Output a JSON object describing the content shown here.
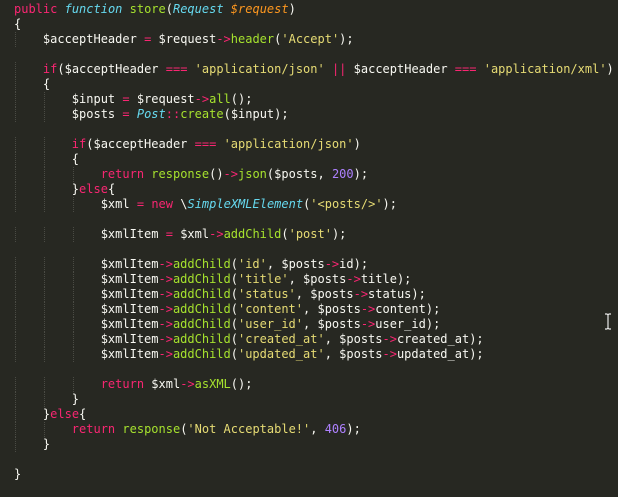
{
  "editor": {
    "language": "php",
    "theme_colors": {
      "background": "#272822",
      "keyword": "#f92672",
      "storage": "#66d9ef",
      "function_name": "#a6e22e",
      "string": "#e6db74",
      "number": "#ae81ff",
      "parameter": "#fd971f",
      "text": "#f8f8f2"
    },
    "lines": [
      {
        "indent": 0,
        "tokens": [
          [
            "kw",
            "public"
          ],
          [
            "tx",
            " "
          ],
          [
            "st",
            "function"
          ],
          [
            "tx",
            " "
          ],
          [
            "fn",
            "store"
          ],
          [
            "pu",
            "("
          ],
          [
            "ty",
            "Request"
          ],
          [
            "tx",
            " "
          ],
          [
            "prm",
            "$request"
          ],
          [
            "pu",
            ")"
          ]
        ]
      },
      {
        "indent": 0,
        "tokens": [
          [
            "pu",
            "{"
          ]
        ]
      },
      {
        "indent": 1,
        "tokens": [
          [
            "var",
            "$acceptHeader"
          ],
          [
            "tx",
            " "
          ],
          [
            "kw",
            "="
          ],
          [
            "tx",
            " "
          ],
          [
            "var",
            "$request"
          ],
          [
            "kw",
            "->"
          ],
          [
            "fn",
            "header"
          ],
          [
            "pu",
            "("
          ],
          [
            "str",
            "'Accept'"
          ],
          [
            "pu",
            ");"
          ]
        ]
      },
      {
        "indent": 0,
        "tokens": []
      },
      {
        "indent": 1,
        "tokens": [
          [
            "kw",
            "if"
          ],
          [
            "pu",
            "("
          ],
          [
            "var",
            "$acceptHeader"
          ],
          [
            "tx",
            " "
          ],
          [
            "kw",
            "==="
          ],
          [
            "tx",
            " "
          ],
          [
            "str",
            "'application/json'"
          ],
          [
            "tx",
            " "
          ],
          [
            "kw",
            "||"
          ],
          [
            "tx",
            " "
          ],
          [
            "var",
            "$acceptHeader"
          ],
          [
            "tx",
            " "
          ],
          [
            "kw",
            "==="
          ],
          [
            "tx",
            " "
          ],
          [
            "str",
            "'application/xml'"
          ],
          [
            "pu",
            ")"
          ]
        ]
      },
      {
        "indent": 1,
        "tokens": [
          [
            "pu",
            "{"
          ]
        ]
      },
      {
        "indent": 2,
        "tokens": [
          [
            "var",
            "$input"
          ],
          [
            "tx",
            " "
          ],
          [
            "kw",
            "="
          ],
          [
            "tx",
            " "
          ],
          [
            "var",
            "$request"
          ],
          [
            "kw",
            "->"
          ],
          [
            "fn",
            "all"
          ],
          [
            "pu",
            "();"
          ]
        ]
      },
      {
        "indent": 2,
        "tokens": [
          [
            "var",
            "$posts"
          ],
          [
            "tx",
            " "
          ],
          [
            "kw",
            "="
          ],
          [
            "tx",
            " "
          ],
          [
            "ty",
            "Post"
          ],
          [
            "kw",
            "::"
          ],
          [
            "fn",
            "create"
          ],
          [
            "pu",
            "("
          ],
          [
            "var",
            "$input"
          ],
          [
            "pu",
            ");"
          ]
        ]
      },
      {
        "indent": 0,
        "tokens": []
      },
      {
        "indent": 2,
        "tokens": [
          [
            "kw",
            "if"
          ],
          [
            "pu",
            "("
          ],
          [
            "var",
            "$acceptHeader"
          ],
          [
            "tx",
            " "
          ],
          [
            "kw",
            "==="
          ],
          [
            "tx",
            " "
          ],
          [
            "str",
            "'application/json'"
          ],
          [
            "pu",
            ")"
          ]
        ]
      },
      {
        "indent": 2,
        "tokens": [
          [
            "pu",
            "{"
          ]
        ]
      },
      {
        "indent": 3,
        "tokens": [
          [
            "kw",
            "return"
          ],
          [
            "tx",
            " "
          ],
          [
            "fn",
            "response"
          ],
          [
            "pu",
            "()"
          ],
          [
            "kw",
            "->"
          ],
          [
            "fn",
            "json"
          ],
          [
            "pu",
            "("
          ],
          [
            "var",
            "$posts"
          ],
          [
            "pu",
            ", "
          ],
          [
            "num",
            "200"
          ],
          [
            "pu",
            ");"
          ]
        ]
      },
      {
        "indent": 2,
        "tokens": [
          [
            "pu",
            "}"
          ],
          [
            "kw",
            "else"
          ],
          [
            "pu",
            "{"
          ]
        ]
      },
      {
        "indent": 3,
        "tokens": [
          [
            "var",
            "$xml"
          ],
          [
            "tx",
            " "
          ],
          [
            "kw",
            "="
          ],
          [
            "tx",
            " "
          ],
          [
            "kw",
            "new"
          ],
          [
            "tx",
            " "
          ],
          [
            "pu",
            "\\"
          ],
          [
            "ty",
            "SimpleXMLElement"
          ],
          [
            "pu",
            "("
          ],
          [
            "str",
            "'<posts/>'"
          ],
          [
            "pu",
            ");"
          ]
        ]
      },
      {
        "indent": 0,
        "tokens": []
      },
      {
        "indent": 3,
        "tokens": [
          [
            "var",
            "$xmlItem"
          ],
          [
            "tx",
            " "
          ],
          [
            "kw",
            "="
          ],
          [
            "tx",
            " "
          ],
          [
            "var",
            "$xml"
          ],
          [
            "kw",
            "->"
          ],
          [
            "fn",
            "addChild"
          ],
          [
            "pu",
            "("
          ],
          [
            "str",
            "'post'"
          ],
          [
            "pu",
            ");"
          ]
        ]
      },
      {
        "indent": 0,
        "tokens": []
      },
      {
        "indent": 3,
        "tokens": [
          [
            "var",
            "$xmlItem"
          ],
          [
            "kw",
            "->"
          ],
          [
            "fn",
            "addChild"
          ],
          [
            "pu",
            "("
          ],
          [
            "str",
            "'id'"
          ],
          [
            "pu",
            ", "
          ],
          [
            "var",
            "$posts"
          ],
          [
            "kw",
            "->"
          ],
          [
            "var",
            "id"
          ],
          [
            "pu",
            ");"
          ]
        ]
      },
      {
        "indent": 3,
        "tokens": [
          [
            "var",
            "$xmlItem"
          ],
          [
            "kw",
            "->"
          ],
          [
            "fn",
            "addChild"
          ],
          [
            "pu",
            "("
          ],
          [
            "str",
            "'title'"
          ],
          [
            "pu",
            ", "
          ],
          [
            "var",
            "$posts"
          ],
          [
            "kw",
            "->"
          ],
          [
            "var",
            "title"
          ],
          [
            "pu",
            ");"
          ]
        ]
      },
      {
        "indent": 3,
        "tokens": [
          [
            "var",
            "$xmlItem"
          ],
          [
            "kw",
            "->"
          ],
          [
            "fn",
            "addChild"
          ],
          [
            "pu",
            "("
          ],
          [
            "str",
            "'status'"
          ],
          [
            "pu",
            ", "
          ],
          [
            "var",
            "$posts"
          ],
          [
            "kw",
            "->"
          ],
          [
            "var",
            "status"
          ],
          [
            "pu",
            ");"
          ]
        ]
      },
      {
        "indent": 3,
        "tokens": [
          [
            "var",
            "$xmlItem"
          ],
          [
            "kw",
            "->"
          ],
          [
            "fn",
            "addChild"
          ],
          [
            "pu",
            "("
          ],
          [
            "str",
            "'content'"
          ],
          [
            "pu",
            ", "
          ],
          [
            "var",
            "$posts"
          ],
          [
            "kw",
            "->"
          ],
          [
            "var",
            "content"
          ],
          [
            "pu",
            ");"
          ]
        ]
      },
      {
        "indent": 3,
        "tokens": [
          [
            "var",
            "$xmlItem"
          ],
          [
            "kw",
            "->"
          ],
          [
            "fn",
            "addChild"
          ],
          [
            "pu",
            "("
          ],
          [
            "str",
            "'user_id'"
          ],
          [
            "pu",
            ", "
          ],
          [
            "var",
            "$posts"
          ],
          [
            "kw",
            "->"
          ],
          [
            "var",
            "user_id"
          ],
          [
            "pu",
            ");"
          ]
        ]
      },
      {
        "indent": 3,
        "tokens": [
          [
            "var",
            "$xmlItem"
          ],
          [
            "kw",
            "->"
          ],
          [
            "fn",
            "addChild"
          ],
          [
            "pu",
            "("
          ],
          [
            "str",
            "'created_at'"
          ],
          [
            "pu",
            ", "
          ],
          [
            "var",
            "$posts"
          ],
          [
            "kw",
            "->"
          ],
          [
            "var",
            "created_at"
          ],
          [
            "pu",
            ");"
          ]
        ]
      },
      {
        "indent": 3,
        "tokens": [
          [
            "var",
            "$xmlItem"
          ],
          [
            "kw",
            "->"
          ],
          [
            "fn",
            "addChild"
          ],
          [
            "pu",
            "("
          ],
          [
            "str",
            "'updated_at'"
          ],
          [
            "pu",
            ", "
          ],
          [
            "var",
            "$posts"
          ],
          [
            "kw",
            "->"
          ],
          [
            "var",
            "updated_at"
          ],
          [
            "pu",
            ");"
          ]
        ]
      },
      {
        "indent": 0,
        "tokens": []
      },
      {
        "indent": 3,
        "tokens": [
          [
            "kw",
            "return"
          ],
          [
            "tx",
            " "
          ],
          [
            "var",
            "$xml"
          ],
          [
            "kw",
            "->"
          ],
          [
            "fn",
            "asXML"
          ],
          [
            "pu",
            "();"
          ]
        ]
      },
      {
        "indent": 2,
        "tokens": [
          [
            "pu",
            "}"
          ]
        ]
      },
      {
        "indent": 1,
        "tokens": [
          [
            "pu",
            "}"
          ],
          [
            "kw",
            "else"
          ],
          [
            "pu",
            "{"
          ]
        ]
      },
      {
        "indent": 2,
        "tokens": [
          [
            "kw",
            "return"
          ],
          [
            "tx",
            " "
          ],
          [
            "fn",
            "response"
          ],
          [
            "pu",
            "("
          ],
          [
            "str",
            "'Not Acceptable!'"
          ],
          [
            "pu",
            ", "
          ],
          [
            "num",
            "406"
          ],
          [
            "pu",
            ");"
          ]
        ]
      },
      {
        "indent": 1,
        "tokens": [
          [
            "pu",
            "}"
          ]
        ]
      },
      {
        "indent": 0,
        "tokens": []
      },
      {
        "indent": 0,
        "tokens": [
          [
            "pu",
            "}"
          ]
        ]
      }
    ],
    "cursor_icon": "text-cursor-icon"
  }
}
